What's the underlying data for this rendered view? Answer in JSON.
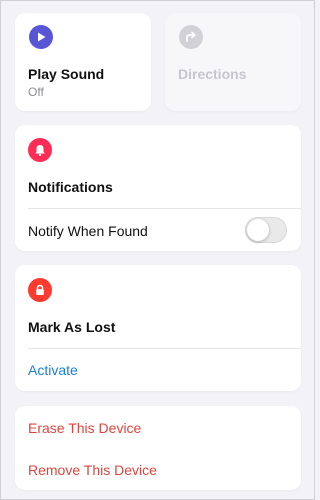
{
  "tiles": {
    "play_sound": {
      "title": "Play Sound",
      "status": "Off",
      "icon": "play-icon",
      "color": "#5856d6"
    },
    "directions": {
      "title": "Directions",
      "icon": "directions-arrow-icon",
      "color": "#d1d1d6",
      "enabled": false
    }
  },
  "notifications": {
    "title": "Notifications",
    "icon": "bell-icon",
    "icon_color": "#ff2d55",
    "notify_when_found_label": "Notify When Found",
    "notify_when_found_on": false
  },
  "lost_mode": {
    "title": "Mark As Lost",
    "icon": "lock-icon",
    "icon_color": "#ff3b30",
    "activate_label": "Activate",
    "link_color": "#1a7fd9"
  },
  "device_actions": {
    "erase_label": "Erase This Device",
    "remove_label": "Remove This Device",
    "destructive_color": "#e0443e"
  }
}
